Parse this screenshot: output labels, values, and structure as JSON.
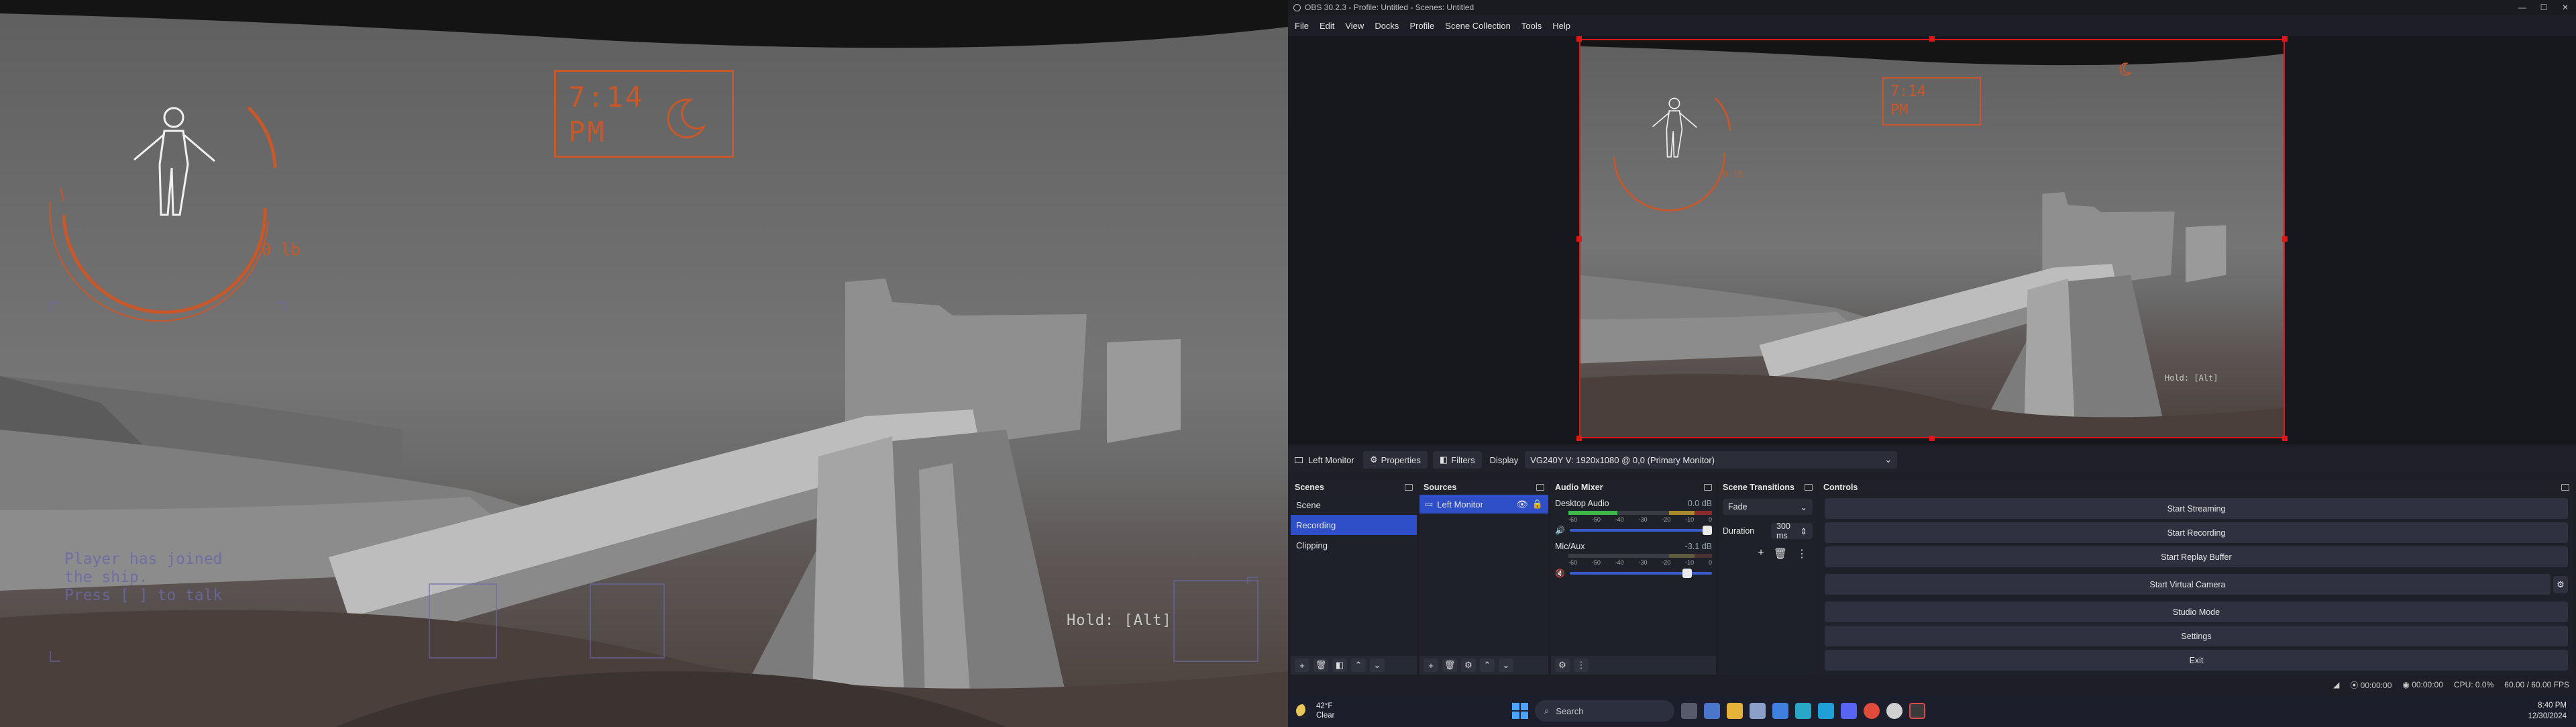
{
  "game": {
    "hud_time": "7:14",
    "hud_ampm": "PM",
    "hud_weight": "0 lb",
    "hud_left_lines": [
      "Player has joined",
      "the ship.",
      "Press [ ] to talk"
    ],
    "hud_hold": "Hold: [Alt]",
    "icons": [
      "astronaut-icon",
      "moon-icon"
    ]
  },
  "obs": {
    "title": "OBS 30.2.3 - Profile: Untitled - Scenes: Untitled",
    "menu": [
      "File",
      "Edit",
      "View",
      "Docks",
      "Profile",
      "Scene Collection",
      "Tools",
      "Help"
    ],
    "source_bar": {
      "source_name": "Left Monitor",
      "properties": "Properties",
      "filters": "Filters",
      "display_label": "Display",
      "display_value": "VG240Y V: 1920x1080 @ 0,0 (Primary Monitor)"
    },
    "scenes": {
      "title": "Scenes",
      "items": [
        "Scene",
        "Recording",
        "Clipping"
      ],
      "selected": "Recording"
    },
    "sources": {
      "title": "Sources",
      "items": [
        "Left Monitor"
      ]
    },
    "mixer": {
      "title": "Audio Mixer",
      "channels": [
        {
          "name": "Desktop Audio",
          "db": "0.0 dB",
          "level": 0.34
        },
        {
          "name": "Mic/Aux",
          "db": "-3.1 dB",
          "level": 0.0
        }
      ],
      "scale": [
        "-60",
        "-55",
        "-50",
        "-45",
        "-40",
        "-35",
        "-30",
        "-25",
        "-20",
        "-15",
        "-10",
        "-5",
        "0"
      ]
    },
    "transitions": {
      "title": "Scene Transitions",
      "type": "Fade",
      "duration_label": "Duration",
      "duration": "300 ms"
    },
    "controls": {
      "title": "Controls",
      "buttons": [
        "Start Streaming",
        "Start Recording",
        "Start Replay Buffer",
        "Start Virtual Camera",
        "Studio Mode",
        "Settings",
        "Exit"
      ]
    },
    "status": {
      "rec_time": "00:00:00",
      "stream_time": "00:00:00",
      "cpu": "CPU: 0.0%",
      "fps": "60.00 / 60.00 FPS"
    }
  },
  "taskbar": {
    "temp": "42°F",
    "condition": "Clear",
    "search": "Search",
    "time": "8:40 PM",
    "date": "12/30/2024"
  },
  "colors": {
    "hud_orange": "#c8572a",
    "selection_blue": "#2f4fc9",
    "selection_red": "#e01717"
  }
}
